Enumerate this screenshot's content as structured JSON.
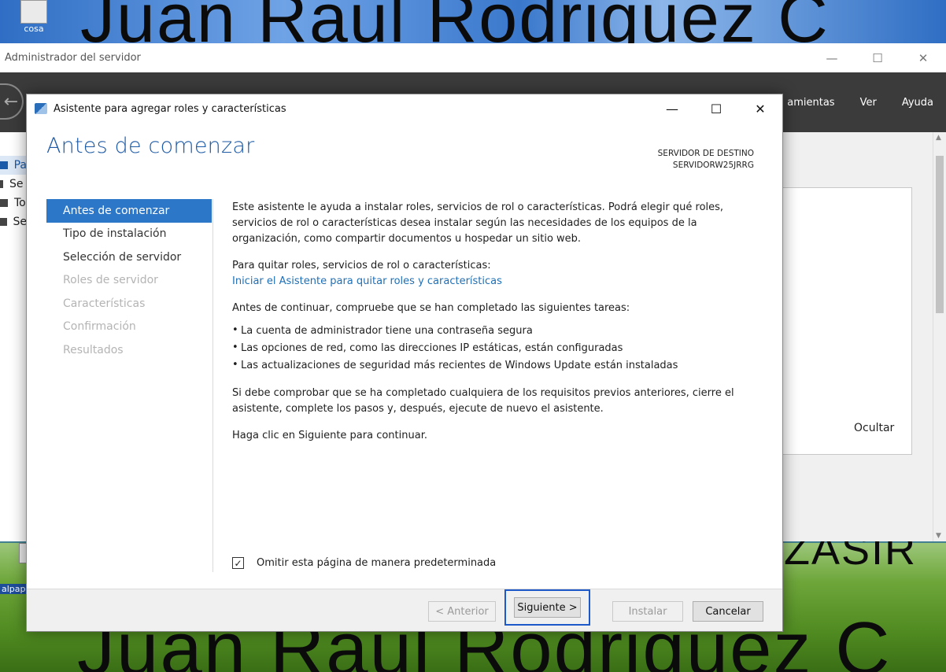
{
  "desktop": {
    "watermark_top": "Juan Raul Rodriguez C",
    "watermark_bottom": "Juan Raul Rodriguez C",
    "watermark_mid": "ZASIR",
    "icon1_label": "cosa",
    "icon2_label": "alpap"
  },
  "server_manager": {
    "title": "Administrador del servidor",
    "controls": {
      "minimize": "—",
      "maximize": "☐",
      "close": "✕"
    },
    "menu": [
      "amientas",
      "Ver",
      "Ayuda"
    ],
    "sidebar": [
      {
        "label": "Pa",
        "selected": true
      },
      {
        "label": "Se",
        "selected": false
      },
      {
        "label": "To",
        "selected": false
      },
      {
        "label": "Se",
        "selected": false
      }
    ],
    "hide_label": "Ocultar"
  },
  "wizard": {
    "title": "Asistente para agregar roles y características",
    "controls": {
      "minimize": "—",
      "maximize": "☐",
      "close": "✕"
    },
    "heading": "Antes de comenzar",
    "dest_server_label": "SERVIDOR DE DESTINO",
    "dest_server_name": "SERVIDORW25JRRG",
    "nav": [
      {
        "label": "Antes de comenzar",
        "state": "active"
      },
      {
        "label": "Tipo de instalación",
        "state": "enabled"
      },
      {
        "label": "Selección de servidor",
        "state": "enabled"
      },
      {
        "label": "Roles de servidor",
        "state": "disabled"
      },
      {
        "label": "Características",
        "state": "disabled"
      },
      {
        "label": "Confirmación",
        "state": "disabled"
      },
      {
        "label": "Resultados",
        "state": "disabled"
      }
    ],
    "content": {
      "intro": "Este asistente le ayuda a instalar roles, servicios de rol o características. Podrá elegir qué roles, servicios de rol o características desea instalar según las necesidades de los equipos de la organización, como compartir documentos u hospedar un sitio web.",
      "remove_label": "Para quitar roles, servicios de rol o características:",
      "remove_link": "Iniciar el Asistente para quitar roles y características",
      "before_continue": "Antes de continuar, compruebe que se han completado las siguientes tareas:",
      "bullets": [
        "La cuenta de administrador tiene una contraseña segura",
        "Las opciones de red, como las direcciones IP estáticas, están configuradas",
        "Las actualizaciones de seguridad más recientes de Windows Update están instaladas"
      ],
      "prereq_note": "Si debe comprobar que se ha completado cualquiera de los requisitos previos anteriores, cierre el asistente, complete los pasos y, después, ejecute de nuevo el asistente.",
      "click_next": "Haga clic en Siguiente para continuar."
    },
    "skip_checkbox": {
      "label": "Omitir esta página de manera predeterminada",
      "checked": true,
      "mark": "✓"
    },
    "buttons": {
      "previous": "< Anterior",
      "next": "Siguiente >",
      "install": "Instalar",
      "cancel": "Cancelar"
    }
  }
}
